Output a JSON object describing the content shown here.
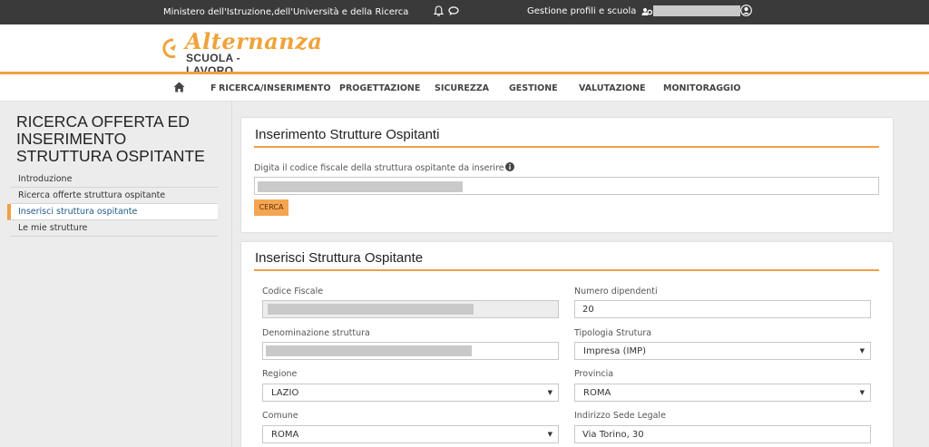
{
  "topbar": {
    "ministry": "Ministero dell'Istruzione,dell'Università e della Ricerca",
    "profiles_label": "Gestione profili e scuola"
  },
  "header": {
    "logo_script": "Alternanza",
    "logo_sub": "SCUOLA - LAVORO"
  },
  "nav": {
    "sep": "F",
    "items": [
      "RICERCA/INSERIMENTO",
      "PROGETTAZIONE",
      "SICUREZZA",
      "GESTIONE",
      "VALUTAZIONE",
      "MONITORAGGIO"
    ]
  },
  "sidebar": {
    "title": "RICERCA OFFERTA ED INSERIMENTO STRUTTURA OSPITANTE",
    "items": [
      {
        "label": "Introduzione"
      },
      {
        "label": "Ricerca offerte struttura ospitante"
      },
      {
        "label": "Inserisci struttura ospitante"
      },
      {
        "label": "Le mie strutture"
      }
    ]
  },
  "search_panel": {
    "title": "Inserimento Strutture Ospitanti",
    "field_label": "Digita il codice fiscale della struttura ospitante da inserire",
    "button": "CERCA"
  },
  "form_panel": {
    "title": "Inserisci Struttura Ospitante",
    "codice_fiscale_label": "Codice Fiscale",
    "numero_dipendenti_label": "Numero dipendenti",
    "numero_dipendenti_value": "20",
    "denominazione_label": "Denominazione struttura",
    "tipologia_label": "Tipologia Strutura",
    "tipologia_value": "Impresa (IMP)",
    "regione_label": "Regione",
    "regione_value": "LAZIO",
    "provincia_label": "Provincia",
    "provincia_value": "ROMA",
    "comune_label": "Comune",
    "comune_value": "ROMA",
    "indirizzo_label": "Indirizzo Sede Legale",
    "indirizzo_value": "Via Torino, 30"
  },
  "colors": {
    "accent": "#f0a044",
    "topbar": "#3a3a3a",
    "active_link": "#1e5a8c"
  },
  "icons": [
    "bell-icon",
    "chat-icon",
    "users-cog-icon",
    "user-circle-icon",
    "home-icon",
    "info-icon",
    "dropdown-caret-icon"
  ]
}
